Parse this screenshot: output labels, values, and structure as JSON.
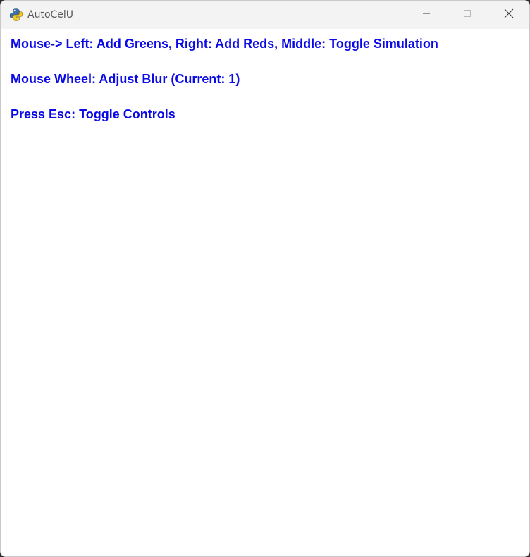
{
  "window": {
    "title": "AutoCelU",
    "icon": "python-snake-icon"
  },
  "titlebar_controls": {
    "minimize_icon": "minimize-icon",
    "maximize_icon": "maximize-icon",
    "close_icon": "close-icon"
  },
  "instructions": {
    "line1": "Mouse-> Left: Add Greens, Right: Add Reds, Middle: Toggle Simulation",
    "line2": "Mouse Wheel: Adjust Blur (Current: 1)",
    "line3": "Press Esc: Toggle Controls"
  },
  "colors": {
    "text": "#0a0ae6",
    "background": "#ffffff",
    "titlebar": "#f3f3f3"
  }
}
